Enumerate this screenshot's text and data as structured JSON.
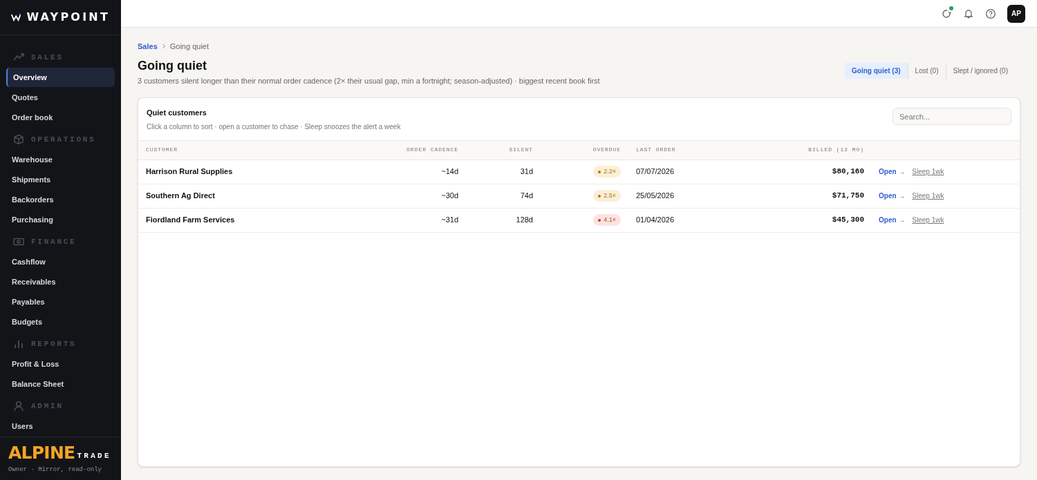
{
  "brand": {
    "name": "WAYPOINT"
  },
  "sidebar": {
    "sections": [
      {
        "title": "SALES",
        "items": [
          {
            "label": "Overview",
            "selected": true
          },
          {
            "label": "Quotes",
            "selected": false
          },
          {
            "label": "Order book",
            "selected": false
          }
        ]
      },
      {
        "title": "OPERATIONS",
        "items": [
          {
            "label": "Warehouse",
            "selected": false
          },
          {
            "label": "Shipments",
            "selected": false
          },
          {
            "label": "Backorders",
            "selected": false
          },
          {
            "label": "Purchasing",
            "selected": false
          }
        ]
      },
      {
        "title": "FINANCE",
        "items": [
          {
            "label": "Cashflow",
            "selected": false
          },
          {
            "label": "Receivables",
            "selected": false
          },
          {
            "label": "Payables",
            "selected": false
          },
          {
            "label": "Budgets",
            "selected": false
          }
        ]
      },
      {
        "title": "REPORTS",
        "items": [
          {
            "label": "Profit & Loss",
            "selected": false
          },
          {
            "label": "Balance Sheet",
            "selected": false
          }
        ]
      },
      {
        "title": "ADMIN",
        "items": [
          {
            "label": "Users",
            "selected": false
          }
        ]
      }
    ],
    "footer": {
      "logo": "ALPINE",
      "logo_suffix": "TRADE",
      "role": "Owner · Mirror, read-only"
    }
  },
  "topbar": {
    "avatar": "AP"
  },
  "breadcrumb": [
    "Sales",
    "Going quiet"
  ],
  "page": {
    "title": "Going quiet",
    "subtitle": "3 customers silent longer than their normal order cadence (2× their usual gap, min a fortnight; season-adjusted) · biggest recent book first"
  },
  "tabs": [
    {
      "label": "Going quiet (3)",
      "selected": true
    },
    {
      "label": "Lost (0)",
      "selected": false
    },
    {
      "label": "Slept / ignored (0)",
      "selected": false
    }
  ],
  "card": {
    "title": "Quiet customers",
    "hint": "Click a column to sort · open a customer to chase · Sleep snoozes the alert a week",
    "search": {
      "placeholder": "Search..."
    }
  },
  "table": {
    "columns": [
      "CUSTOMER",
      "ORDER CADENCE",
      "SILENT",
      "OVERDUE",
      "LAST ORDER",
      "BILLED (12 MO)"
    ],
    "rows": [
      {
        "customer": "Harrison Rural Supplies",
        "cadence": "~14d",
        "silent": "31d",
        "overdue": "2.2×",
        "color": "#a8741a",
        "last_order": "07/07/2026",
        "billed": "$80,160",
        "open": "Open →",
        "sleep": "Sleep 1wk"
      },
      {
        "customer": "Southern Ag Direct",
        "cadence": "~30d",
        "silent": "74d",
        "overdue": "2.5×",
        "color": "#a8741a",
        "last_order": "25/05/2026",
        "billed": "$71,750",
        "open": "Open →",
        "sleep": "Sleep 1wk"
      },
      {
        "customer": "Fiordland Farm Services",
        "cadence": "~31d",
        "silent": "128d",
        "overdue": "4.1×",
        "color": "#b5412d",
        "last_order": "01/04/2026",
        "billed": "$45,300",
        "open": "Open →",
        "sleep": "Sleep 1wk"
      }
    ]
  }
}
